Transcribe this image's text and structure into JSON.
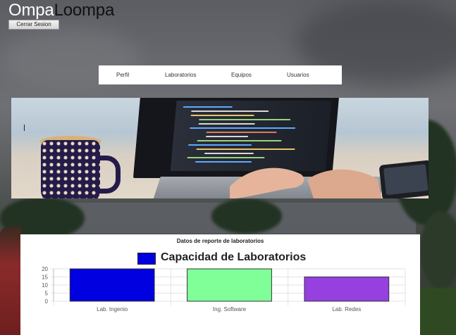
{
  "brand": {
    "part1": "Ompa",
    "part2": "Loompa"
  },
  "logout_label": "Cerrar Sesion",
  "nav": {
    "items": [
      "Perfil",
      "Laboratorios",
      "Equipos",
      "Usuarios"
    ]
  },
  "card": {
    "title": "Datos de reporte de laboratorios"
  },
  "chart_data": {
    "type": "bar",
    "title": "Capacidad de Laboratorios",
    "categories": [
      "Lab. Ingenio",
      "Ing. Software",
      "Lab. Redes"
    ],
    "series": [
      {
        "name": "Capacidad de Laboratorios",
        "values": [
          20,
          20,
          15
        ]
      }
    ],
    "bar_colors": [
      "#0000e0",
      "#80ff98",
      "#9640e0"
    ],
    "legend_color": "#0000e0",
    "ylim": [
      0,
      20
    ],
    "yticks": [
      0,
      5,
      10,
      15,
      20
    ],
    "grid": true,
    "legend_position": "top"
  },
  "colors": {
    "nav_bg": "#ffffff",
    "card_bg": "#ffffff"
  }
}
